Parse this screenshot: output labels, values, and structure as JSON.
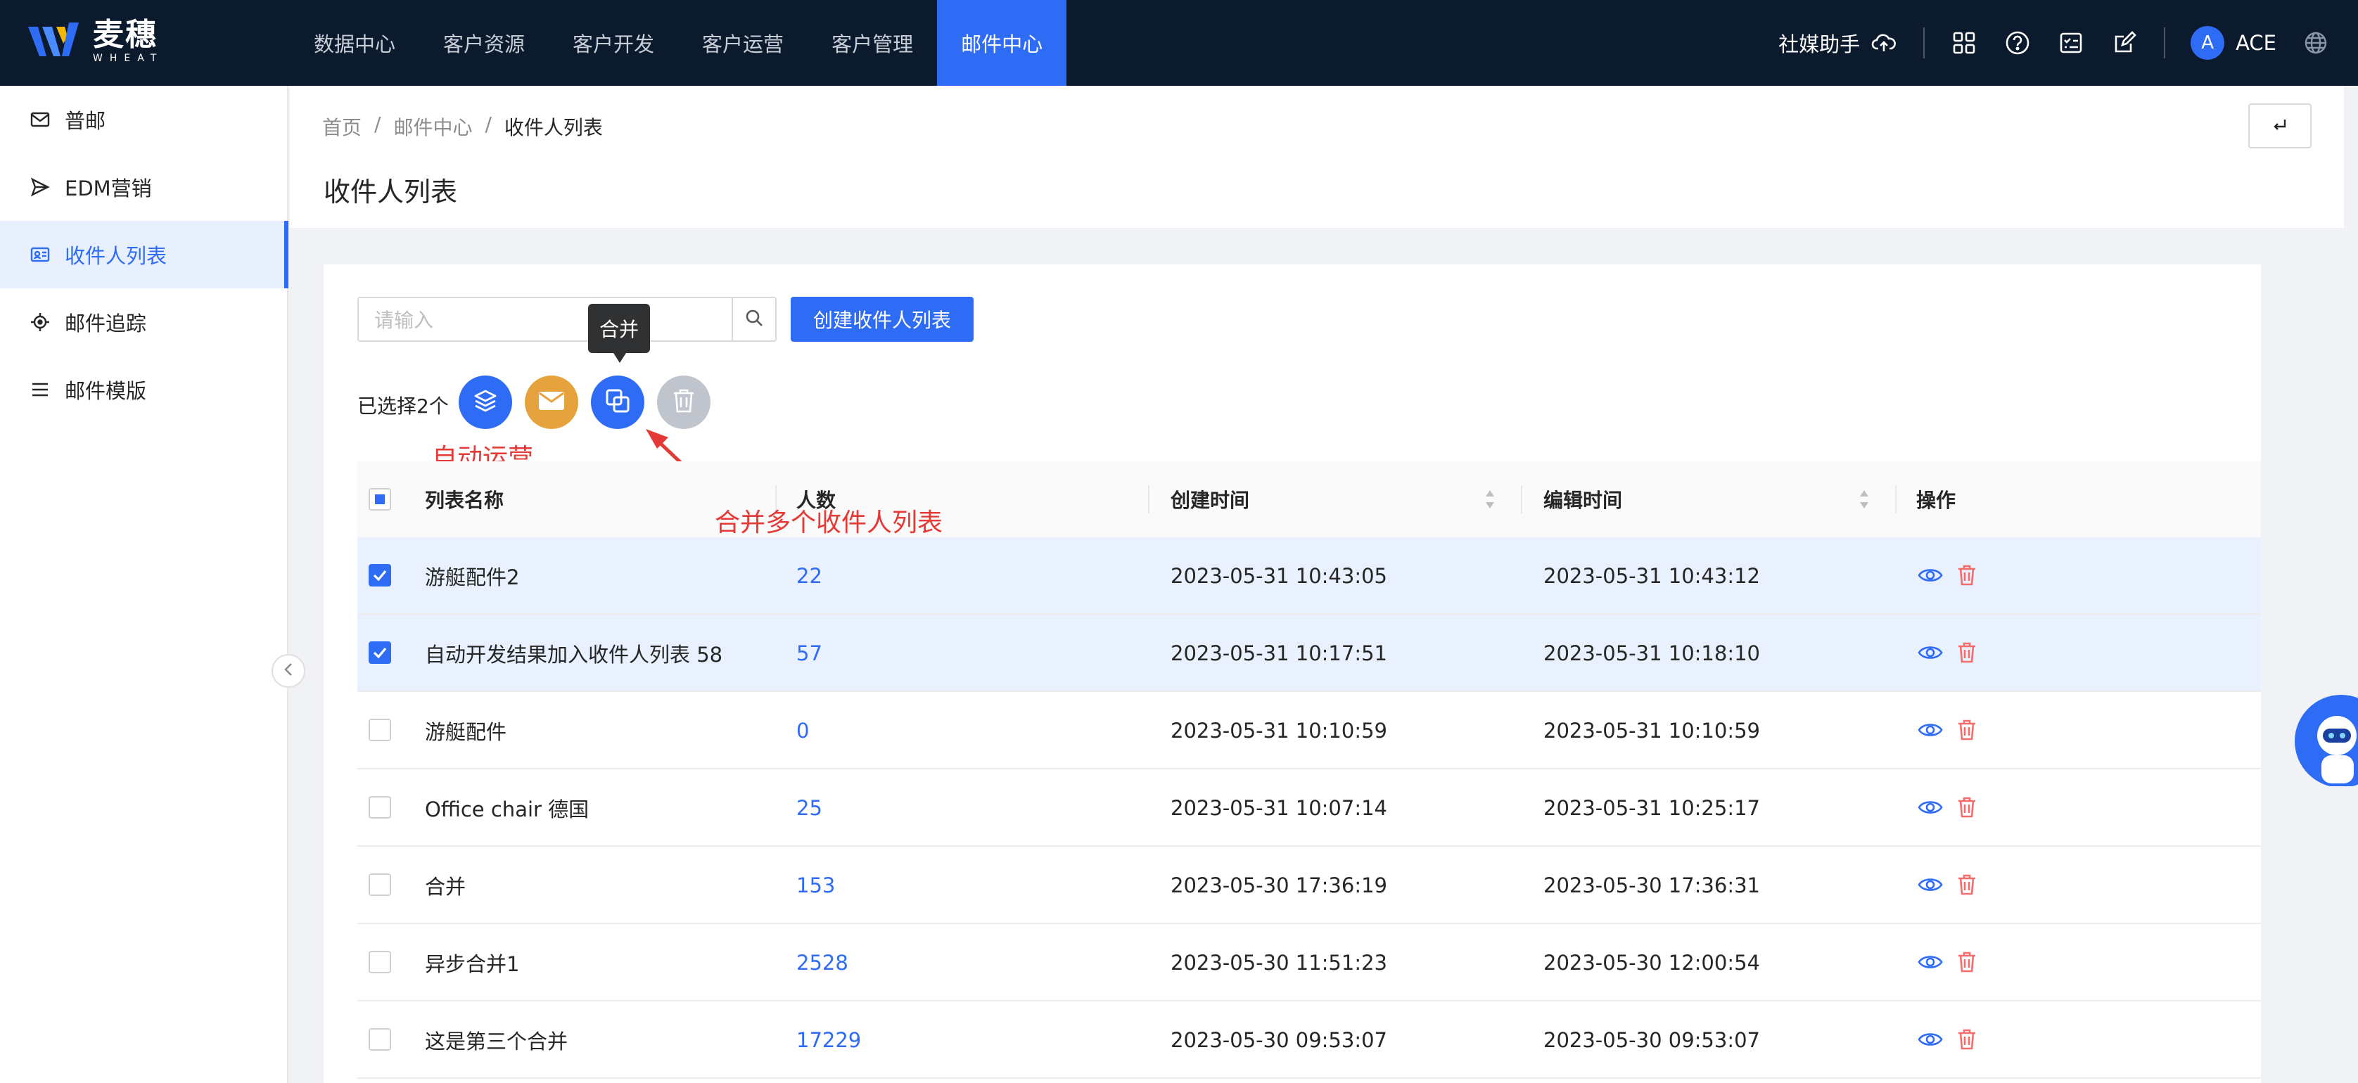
{
  "brand": {
    "name_cn": "麦穗",
    "name_en": "WHEAT"
  },
  "nav": {
    "items": [
      "数据中心",
      "客户资源",
      "客户开发",
      "客户运营",
      "客户管理",
      "邮件中心"
    ],
    "active": "邮件中心"
  },
  "top_right": {
    "assistant": "社媒助手",
    "avatar_letter": "A",
    "username": "ACE"
  },
  "sidebar": {
    "items": [
      {
        "label": "普邮",
        "icon": "mail-icon"
      },
      {
        "label": "EDM营销",
        "icon": "send-icon"
      },
      {
        "label": "收件人列表",
        "icon": "contact-card-icon"
      },
      {
        "label": "邮件追踪",
        "icon": "target-icon"
      },
      {
        "label": "邮件模版",
        "icon": "list-icon"
      }
    ],
    "active": "收件人列表"
  },
  "breadcrumb": [
    "首页",
    "/",
    "邮件中心",
    "/",
    "收件人列表"
  ],
  "page_title": "收件人列表",
  "toolbar": {
    "search_placeholder": "请输入",
    "create_label": "创建收件人列表",
    "tooltip": "合并",
    "selected_text": "已选择2个"
  },
  "annotations": {
    "auto_ops": "自动运营",
    "merge_note": "合并多个收件人列表"
  },
  "table": {
    "headers": [
      "列表名称",
      "人数",
      "创建时间",
      "编辑时间",
      "操作"
    ],
    "rows": [
      {
        "name": "游艇配件2",
        "count": "22",
        "created": "2023-05-31 10:43:05",
        "edited": "2023-05-31 10:43:12",
        "checked": true
      },
      {
        "name": "自动开发结果加入收件人列表 58",
        "count": "57",
        "created": "2023-05-31 10:17:51",
        "edited": "2023-05-31 10:18:10",
        "checked": true
      },
      {
        "name": "游艇配件",
        "count": "0",
        "created": "2023-05-31 10:10:59",
        "edited": "2023-05-31 10:10:59",
        "checked": false
      },
      {
        "name": "Office chair 德国",
        "count": "25",
        "created": "2023-05-31 10:07:14",
        "edited": "2023-05-31 10:25:17",
        "checked": false
      },
      {
        "name": "合并",
        "count": "153",
        "created": "2023-05-30 17:36:19",
        "edited": "2023-05-30 17:36:31",
        "checked": false
      },
      {
        "name": "异步合并1",
        "count": "2528",
        "created": "2023-05-30 11:51:23",
        "edited": "2023-05-30 12:00:54",
        "checked": false
      },
      {
        "name": "这是第三个合并",
        "count": "17229",
        "created": "2023-05-30 09:53:07",
        "edited": "2023-05-30 09:53:07",
        "checked": false
      }
    ]
  },
  "colors": {
    "primary": "#2f6cf6",
    "topbar": "#0b1a2c",
    "annotation": "#e53935",
    "delete": "#f56c6c",
    "mail_button": "#e6a23c"
  }
}
